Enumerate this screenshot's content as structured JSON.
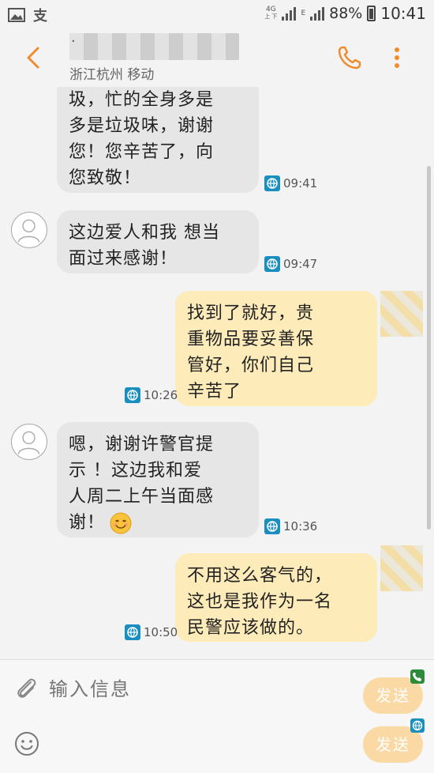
{
  "status_bar": {
    "network_label": "4G",
    "network_sub": "上 下",
    "signal2_label": "E",
    "battery_percent": "88%",
    "time": "10:41",
    "left_icons": [
      "image-icon",
      "alipay-icon"
    ]
  },
  "header": {
    "contact_name": "· ",
    "contact_location": "浙江杭州 移动"
  },
  "messages": [
    {
      "dir": "in",
      "lines": [
        "圾，忙的全身多是",
        "多是垃圾味，谢谢",
        "您！您辛苦了，向",
        "您致敬！"
      ],
      "time": "09:41"
    },
    {
      "dir": "in",
      "lines": [
        "这边爱人和我 想当",
        "面过来感谢！"
      ],
      "time": "09:47"
    },
    {
      "dir": "out",
      "lines": [
        "找到了就好，贵",
        "重物品要妥善保",
        "管好，你们自己",
        "辛苦了"
      ],
      "time": "10:26"
    },
    {
      "dir": "in",
      "lines": [
        "嗯，谢谢许警官提",
        "示 ！这边我和爱",
        "人周二上午当面感",
        "谢！"
      ],
      "time": "10:36"
    },
    {
      "dir": "out",
      "lines": [
        "不用这么客气的，",
        "这也是我作为一名",
        "民警应该做的。"
      ],
      "time": "10:50"
    }
  ],
  "composer": {
    "placeholder": "输入信息",
    "send_label_1": "发送",
    "send_label_2": "发送"
  },
  "colors": {
    "accent": "#f08c2e",
    "incoming_bubble": "#e6e6e6",
    "outgoing_bubble": "#fdebb9",
    "send_button": "#fbd9a4"
  }
}
